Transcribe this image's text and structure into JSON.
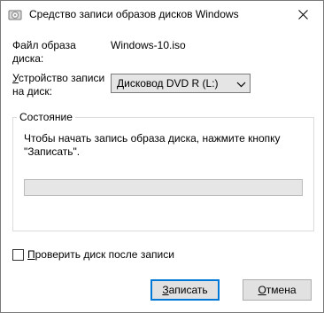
{
  "window": {
    "title": "Средство записи образов дисков Windows"
  },
  "file": {
    "label_line1": "Файл образа",
    "label_line2": "диска:",
    "value": "Windows-10.iso"
  },
  "device": {
    "label_line1_prefix": "",
    "label_line1_mnemonic": "У",
    "label_line1_rest": "стройство записи",
    "label_line2": "на диск:",
    "selected": "Дисковод DVD R (L:)"
  },
  "status": {
    "group_label": "Состояние",
    "message": "Чтобы начать запись образа диска, нажмите кнопку \"Записать\".",
    "progress": 0
  },
  "verify": {
    "label_mnemonic": "П",
    "label_rest": "роверить диск после записи",
    "checked": false
  },
  "buttons": {
    "burn_mnemonic": "З",
    "burn_rest": "аписать",
    "cancel_mnemonic": "О",
    "cancel_rest": "тмена"
  },
  "colors": {
    "accent": "#0078d7",
    "progress_fill": "#06b025"
  },
  "icons": {
    "app": "disc-burner-icon",
    "close": "close-icon",
    "dropdown": "chevron-down-icon"
  }
}
